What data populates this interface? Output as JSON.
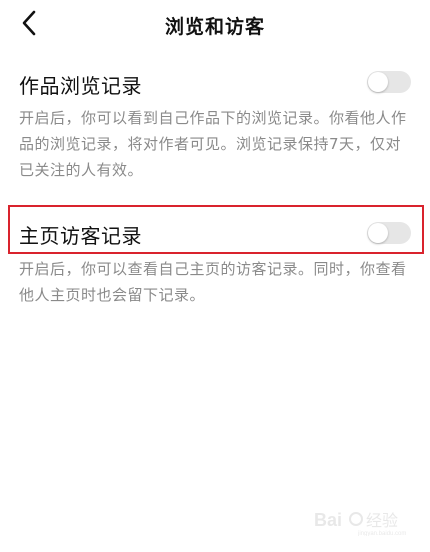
{
  "header": {
    "title": "浏览和访客",
    "back_icon": "chevron-left-icon"
  },
  "settings": [
    {
      "id": "works-browse-record",
      "title": "作品浏览记录",
      "enabled": false,
      "description": "开启后，你可以看到自己作品下的浏览记录。你看他人作品的浏览记录，将对作者可见。浏览记录保持7天，仅对已关注的人有效。"
    },
    {
      "id": "homepage-visitor-record",
      "title": "主页访客记录",
      "enabled": false,
      "highlighted": true,
      "description": "开启后，你可以查看自己主页的访客记录。同时，你查看他人主页时也会留下记录。"
    }
  ],
  "colors": {
    "highlight_border": "#d9232d",
    "toggle_off": "#e6e6e6",
    "description_text": "#8a8a8a"
  },
  "watermark": {
    "text": "Bai经验",
    "subtext": "jingyan.baidu.com"
  }
}
